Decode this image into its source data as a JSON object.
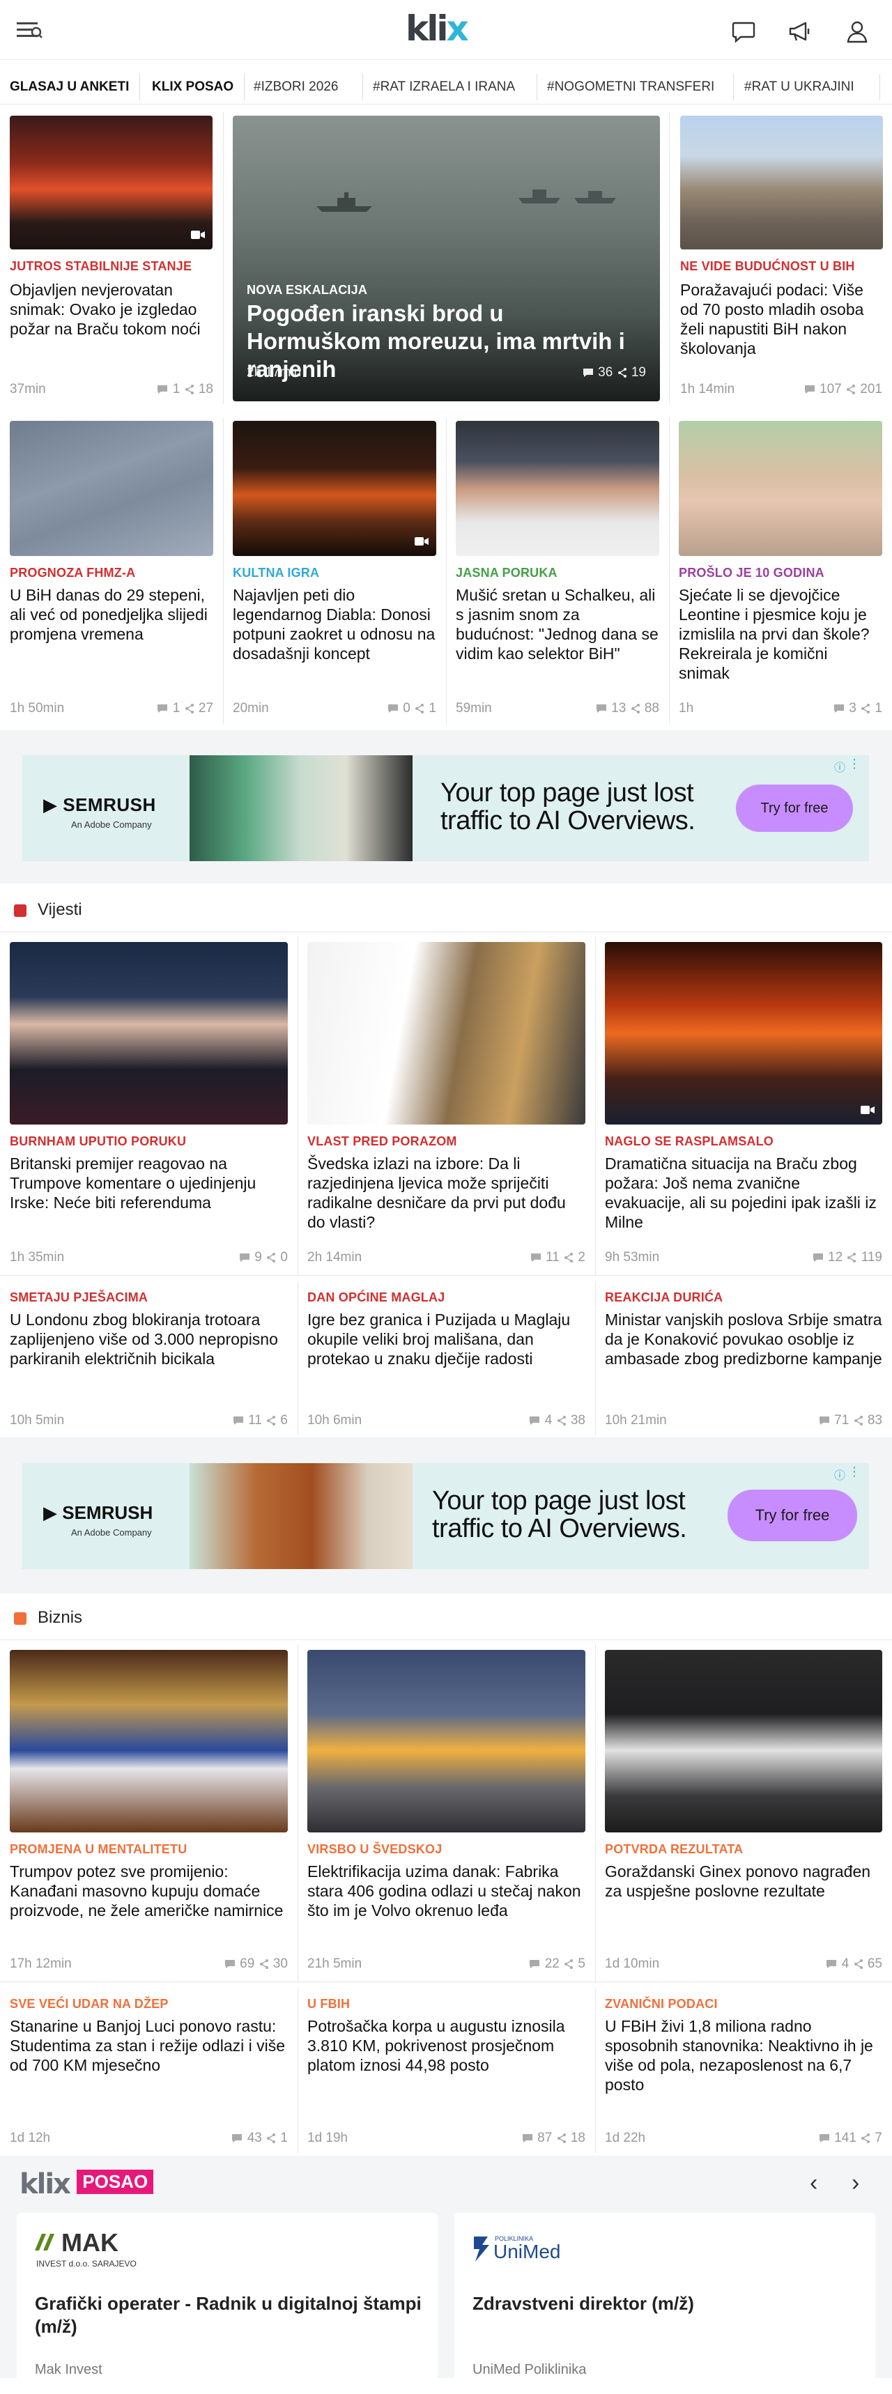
{
  "header": {
    "logo": "klix",
    "menu_icon": "menu-icon",
    "icons": [
      "comments-icon",
      "megaphone-icon",
      "user-icon"
    ]
  },
  "tags": [
    "GLASAJ U ANKETI",
    "KLIX POSAO",
    "#IZBORI 2026",
    "#RAT IZRAELA I IRANA",
    "#NOGOMETNI TRANSFERI",
    "#RAT U UKRAJINI"
  ],
  "top": {
    "featured": {
      "kicker": "NOVA ESKALACIJA",
      "title": "Pogođen iranski brod u Hormuškom moreuzu, ima mrtvih i ranjenih",
      "time": "2h 17min",
      "comments": "36",
      "shares": "19"
    },
    "left": {
      "kicker": "JUTROS STABILNIJE STANJE",
      "title": "Objavljen nevjerovatan snimak: Ovako je izgledao požar na Braču tokom noći",
      "time": "37min",
      "comments": "1",
      "shares": "18"
    },
    "right": {
      "kicker": "NE VIDE BUDUĆNOST U BIH",
      "title": "Poražavajući podaci: Više od 70 posto mladih osoba želi napustiti BiH nakon školovanja",
      "time": "1h 14min",
      "comments": "107",
      "shares": "201"
    },
    "row2": [
      {
        "kicker": "PROGNOZA FHMZ-A",
        "title": "U BiH danas do 29 stepeni, ali već od ponedjeljka slijedi promjena vremena",
        "time": "1h 50min",
        "comments": "1",
        "shares": "27",
        "color": "#d32f2f"
      },
      {
        "kicker": "KULTNA IGRA",
        "title": "Najavljen peti dio legendarnog Diabla: Donosi potpuni zaokret u odnosu na dosadašnji koncept",
        "time": "20min",
        "comments": "0",
        "shares": "1",
        "color": "#2fa8d8"
      },
      {
        "kicker": "JASNA PORUKA",
        "title": "Mušić sretan u Schalkeu, ali s jasnim snom za budućnost: \"Jednog dana se vidim kao selektor BiH\"",
        "time": "59min",
        "comments": "13",
        "shares": "88",
        "color": "#43a047"
      },
      {
        "kicker": "PROŠLO JE 10 GODINA",
        "title": "Sjećate li se djevojčice Leontine i pjesmice koju je izmislila na prvi dan škole? Rekreirala je komični snimak",
        "time": "1h",
        "comments": "3",
        "shares": "1",
        "color": "#9c3fa0"
      }
    ]
  },
  "ad": {
    "brand": "SEMRUSH",
    "brand_sub": "An Adobe Company",
    "headline_1": "Your top page just lost",
    "headline_2": "traffic to AI Overviews.",
    "cta": "Try for free"
  },
  "vijesti": {
    "label": "Vijesti",
    "color": "#d32f2f",
    "row1": [
      {
        "kicker": "BURNHAM UPUTIO PORUKU",
        "title": "Britanski premijer reagovao na Trumpove komentare o ujedinjenju Irske: Neće biti referenduma",
        "time": "1h 35min",
        "comments": "9",
        "shares": "0"
      },
      {
        "kicker": "VLAST PRED PORAZOM",
        "title": "Švedska izlazi na izbore: Da li razjedinjena ljevica može spriječiti radikalne desničare da prvi put dođu do vlasti?",
        "time": "2h 14min",
        "comments": "11",
        "shares": "2"
      },
      {
        "kicker": "NAGLO SE RASPLAMSALO",
        "title": "Dramatična situacija na Braču zbog požara: Još nema zvanične evakuacije, ali su pojedini ipak izašli iz Milne",
        "time": "9h 53min",
        "comments": "12",
        "shares": "119"
      }
    ],
    "row2": [
      {
        "kicker": "SMETAJU PJEŠACIMA",
        "title": "U Londonu zbog blokiranja trotoara zaplijenjeno više od 3.000 nepropisno parkiranih električnih bicikala",
        "time": "10h 5min",
        "comments": "11",
        "shares": "6"
      },
      {
        "kicker": "DAN OPĆINE MAGLAJ",
        "title": "Igre bez granica i Puzijada u Maglaju okupile veliki broj mališana, dan protekao u znaku dječije radosti",
        "time": "10h 6min",
        "comments": "4",
        "shares": "38"
      },
      {
        "kicker": "REAKCIJA DURIĆA",
        "title": "Ministar vanjskih poslova Srbije smatra da je Konaković povukao osoblje iz ambasade zbog predizborne kampanje",
        "time": "10h 21min",
        "comments": "71",
        "shares": "83"
      }
    ]
  },
  "biznis": {
    "label": "Biznis",
    "color": "#f0703a",
    "row1": [
      {
        "kicker": "PROMJENA U MENTALITETU",
        "title": "Trumpov potez sve promijenio: Kanađani masovno kupuju domaće proizvode, ne žele američke namirnice",
        "time": "17h 12min",
        "comments": "69",
        "shares": "30"
      },
      {
        "kicker": "VIRSBO U ŠVEDSKOJ",
        "title": "Elektrifikacija uzima danak: Fabrika stara 406 godina odlazi u stečaj nakon što im je Volvo okrenuo leđa",
        "time": "21h 5min",
        "comments": "22",
        "shares": "5"
      },
      {
        "kicker": "POTVRDA REZULTATA",
        "title": "Goraždanski Ginex ponovo nagrađen za uspješne poslovne rezultate",
        "time": "1d 10min",
        "comments": "4",
        "shares": "65"
      }
    ],
    "row2": [
      {
        "kicker": "SVE VEĆI UDAR NA DŽEP",
        "title": "Stanarine u Banjoj Luci ponovo rastu: Studentima za stan i režije odlazi i više od 700 KM mjesečno",
        "time": "1d 12h",
        "comments": "43",
        "shares": "1"
      },
      {
        "kicker": "U FBIH",
        "title": "Potrošačka korpa u augustu iznosila 3.810 KM, pokrivenost prosječnom platom iznosi 44,98 posto",
        "time": "1d 19h",
        "comments": "87",
        "shares": "18"
      },
      {
        "kicker": "ZVANIČNI PODACI",
        "title": "U FBiH živi 1,8 miliona radno sposobnih stanovnika: Neaktivno ih je više od pola, nezaposlenost na 6,7 posto",
        "time": "1d 22h",
        "comments": "141",
        "shares": "7"
      }
    ]
  },
  "posao": {
    "logo_klix": "klix",
    "logo_posao": "POSAO",
    "jobs": [
      {
        "company_logo": "MAK",
        "company_logo_sub": "INVEST d.o.o. SARAJEVO",
        "title": "Grafički operater - Radnik u digitalnoj štampi (m/ž)",
        "company": "Mak Invest"
      },
      {
        "company_logo": "UniMed",
        "company_logo_sub": "POLIKLINIKA",
        "title": "Zdravstveni direktor (m/ž)",
        "company": "UniMed Poliklinika"
      }
    ]
  }
}
